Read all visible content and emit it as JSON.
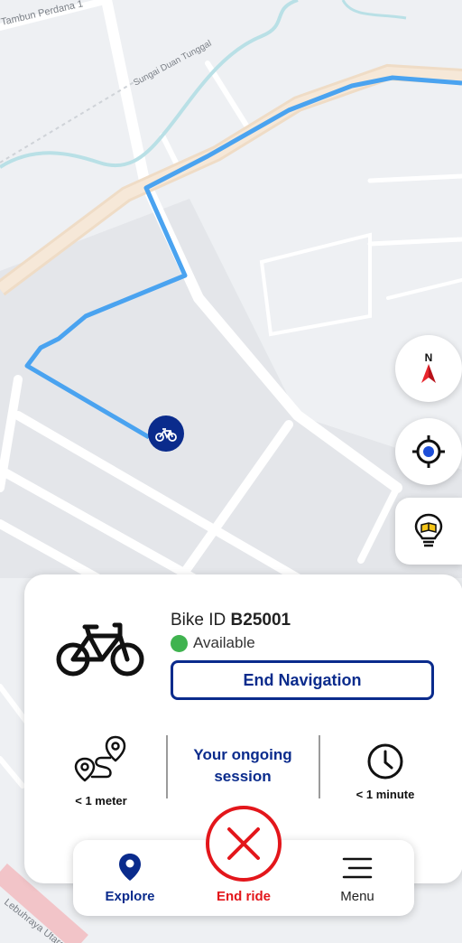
{
  "map": {
    "labels": {
      "street_top": "Tambun Perdana 1",
      "river": "Sungai Duan Tunggal",
      "highway": "Lebuhraya Utara"
    },
    "route_color": "#4aa3f0",
    "bike_marker_color": "#0a2b8c"
  },
  "controls": {
    "compass_letter": "N",
    "compass_icon": "compass-icon",
    "locate_icon": "crosshair-icon",
    "guide_icon": "lightbulb-book-icon"
  },
  "bike_card": {
    "id_label": "Bike ID",
    "id_value": "B25001",
    "status": "Available",
    "status_color": "#3fb34f",
    "end_navigation_label": "End Navigation",
    "distance": "< 1 meter",
    "session_line1": "Your ongoing",
    "session_line2": "session",
    "duration": "< 1 minute"
  },
  "bottom_nav": {
    "explore": "Explore",
    "end_ride": "End ride",
    "menu": "Menu"
  },
  "colors": {
    "brand": "#0a2b8c",
    "danger": "#e3161b"
  }
}
